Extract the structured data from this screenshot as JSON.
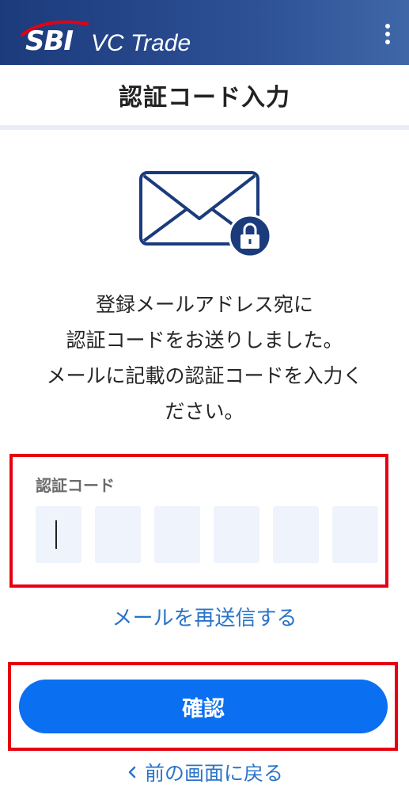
{
  "app": {
    "brand_sbi": "SBI",
    "brand_name": "VC Trade"
  },
  "header": {
    "menu_icon": "more-vertical-icon"
  },
  "page": {
    "title": "認証コード入力"
  },
  "illustration": {
    "icon": "envelope-lock-icon",
    "color": "#1b3b7c"
  },
  "instructions": {
    "line1": "登録メールアドレス宛に",
    "line2": "認証コードをお送りしました。",
    "line3": "メールに記載の認証コードを入力く",
    "line4": "ださい。"
  },
  "code_input": {
    "label": "認証コード",
    "digits": [
      "",
      "",
      "",
      "",
      "",
      ""
    ]
  },
  "links": {
    "resend": "メールを再送信する",
    "back": "前の画面に戻る"
  },
  "buttons": {
    "confirm": "確認"
  },
  "colors": {
    "header": "#1b3b7c",
    "accent": "#0a6ff0",
    "link": "#2b74c8",
    "highlight": "#e60012"
  }
}
